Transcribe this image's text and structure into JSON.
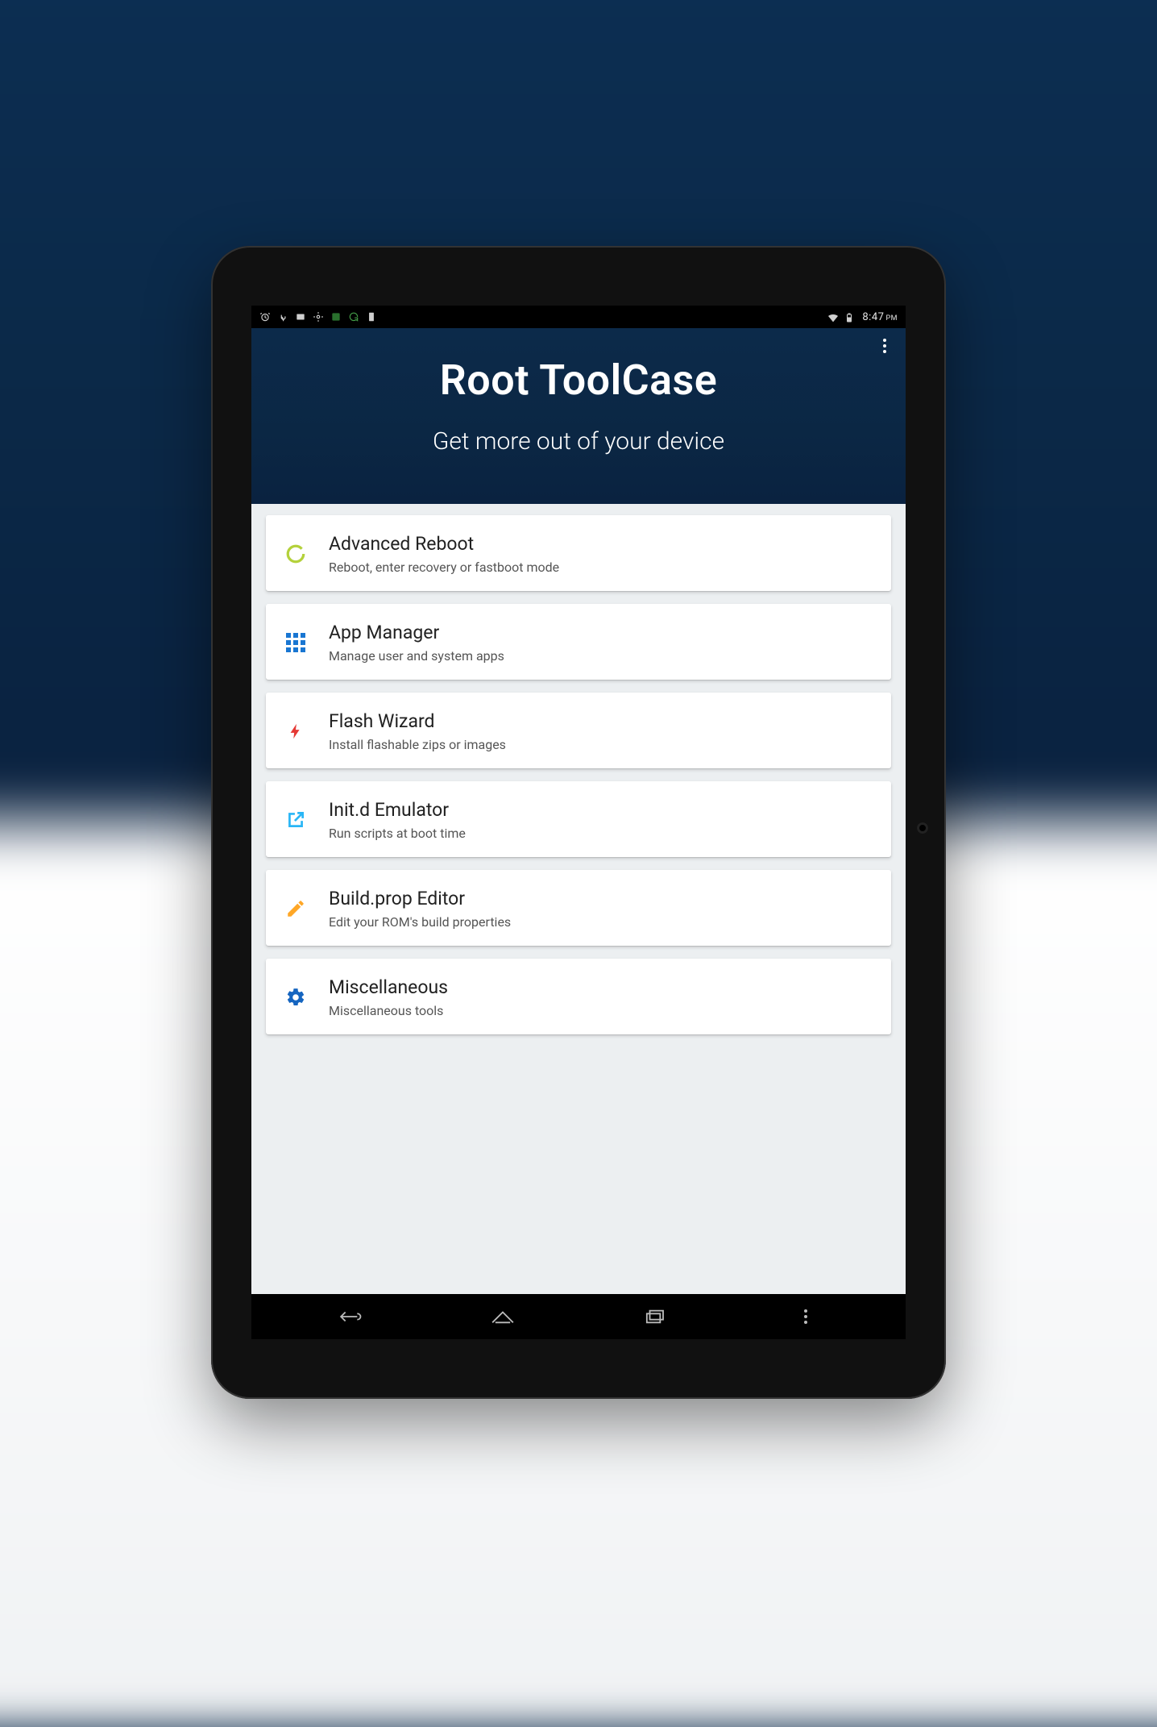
{
  "status_bar": {
    "time": "8:47",
    "period": "PM"
  },
  "header": {
    "title": "Root ToolCase",
    "subtitle": "Get more out of your device"
  },
  "items": [
    {
      "id": "advanced-reboot",
      "title": "Advanced Reboot",
      "subtitle": "Reboot, enter recovery or fastboot mode",
      "icon": "circle",
      "color": "#b4d13b"
    },
    {
      "id": "app-manager",
      "title": "App Manager",
      "subtitle": "Manage user and system apps",
      "icon": "grid",
      "color": "#1976d2"
    },
    {
      "id": "flash-wizard",
      "title": "Flash Wizard",
      "subtitle": "Install flashable zips or images",
      "icon": "flash",
      "color": "#e53935"
    },
    {
      "id": "initd-emulator",
      "title": "Init.d Emulator",
      "subtitle": "Run scripts at boot time",
      "icon": "launch",
      "color": "#29b6f6"
    },
    {
      "id": "buildprop-editor",
      "title": "Build.prop Editor",
      "subtitle": "Edit your ROM's build properties",
      "icon": "edit",
      "color": "#ffa726"
    },
    {
      "id": "miscellaneous",
      "title": "Miscellaneous",
      "subtitle": "Miscellaneous tools",
      "icon": "gear",
      "color": "#1565c0"
    }
  ]
}
